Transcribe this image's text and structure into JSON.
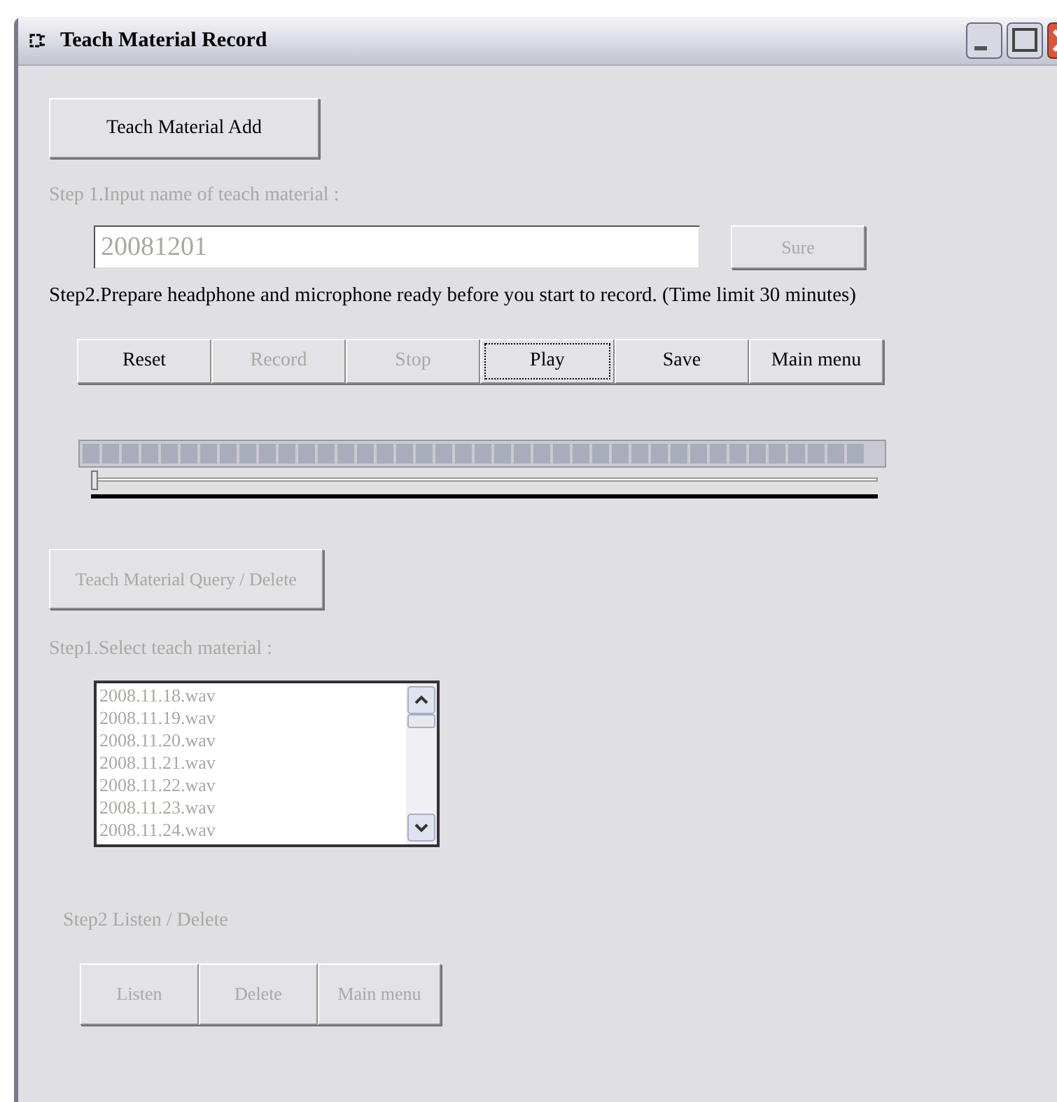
{
  "window": {
    "title": "Teach Material Record"
  },
  "add_button": {
    "label": "Teach Material Add",
    "disabled": false
  },
  "step1_label": {
    "text": "Step 1.Input name of teach material :",
    "disabled": true
  },
  "name_field": {
    "value": "20081201",
    "disabled": true
  },
  "sure_button": {
    "label": "Sure",
    "disabled": true
  },
  "step2_label": {
    "text": "Step2.Prepare headphone and microphone ready before you start to record. (Time limit 30 minutes)",
    "disabled": false
  },
  "record_buttons": [
    {
      "label": "Reset",
      "disabled": false,
      "focused": false
    },
    {
      "label": "Record",
      "disabled": true,
      "focused": false
    },
    {
      "label": "Stop",
      "disabled": true,
      "focused": false
    },
    {
      "label": "Play",
      "disabled": false,
      "focused": true
    },
    {
      "label": "Save",
      "disabled": false,
      "focused": false
    },
    {
      "label": "Main menu",
      "disabled": false,
      "focused": false
    }
  ],
  "meter": {
    "level": 1
  },
  "position_slider": {
    "level": 0
  },
  "query_button": {
    "label": "Teach Material Query / Delete",
    "disabled": true
  },
  "select_label": {
    "text": "Step1.Select teach material :",
    "disabled": true
  },
  "file_list": {
    "disabled": true,
    "items": [
      {
        "label": "2008.11.18.wav",
        "selected": false
      },
      {
        "label": "2008.11.19.wav",
        "selected": false
      },
      {
        "label": "2008.11.20.wav",
        "selected": false
      },
      {
        "label": "2008.11.21.wav",
        "selected": false
      },
      {
        "label": "2008.11.22.wav",
        "selected": false
      },
      {
        "label": "2008.11.23.wav",
        "selected": false
      },
      {
        "label": "2008.11.24.wav",
        "selected": false
      }
    ]
  },
  "listen_label": {
    "text": "Step2 Listen / Delete",
    "disabled": true
  },
  "listen_buttons": [
    {
      "label": "Listen",
      "disabled": true
    },
    {
      "label": "Delete",
      "disabled": true
    },
    {
      "label": "Main menu",
      "disabled": true
    }
  ]
}
